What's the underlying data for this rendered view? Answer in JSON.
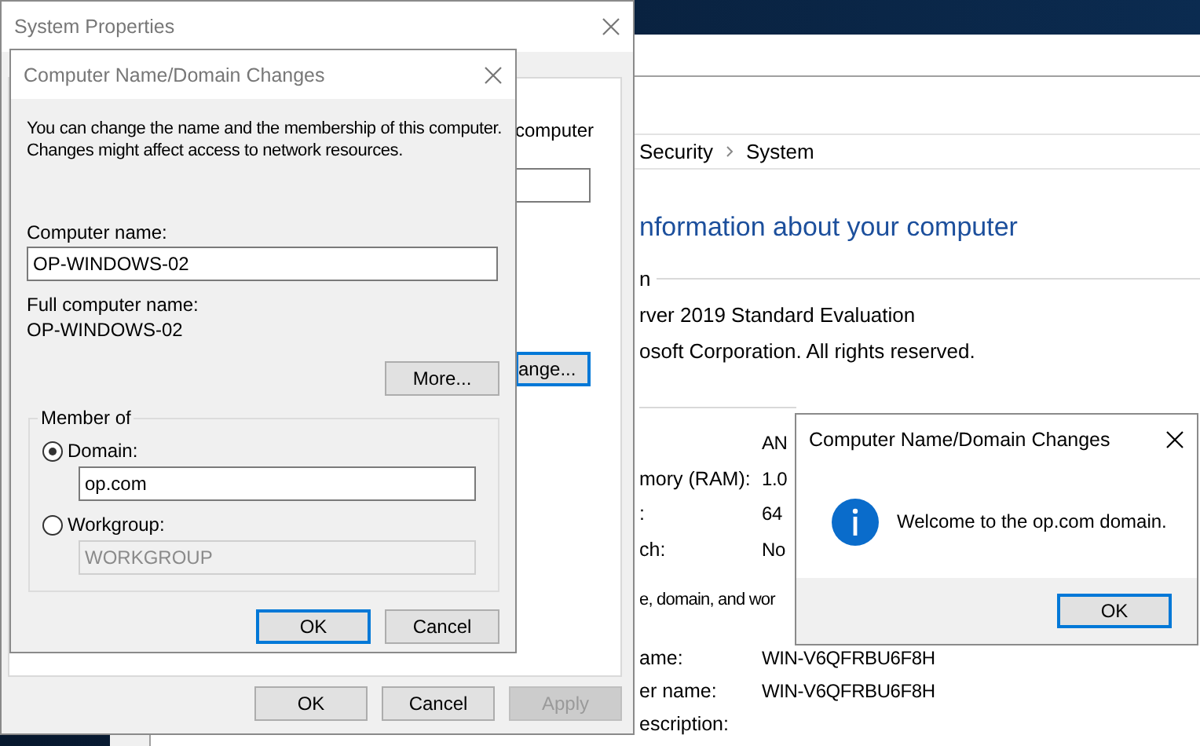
{
  "system_window": {
    "breadcrumb": [
      "Security",
      "System"
    ],
    "heading": "nformation about your computer",
    "edition_label": "n",
    "edition_lines": [
      "rver 2019 Standard Evaluation",
      "osoft Corporation. All rights reserved."
    ],
    "system_rows": [
      {
        "value": "AN"
      },
      {
        "label": "mory (RAM):",
        "value": "1.0"
      },
      {
        "label": ":",
        "value": "64"
      },
      {
        "label": "ch:",
        "value": "No"
      }
    ],
    "name_section_label": "e, domain, and wor",
    "name_rows": [
      {
        "label": "ame:",
        "value": "WIN-V6QFRBU6F8H"
      },
      {
        "label": "er name:",
        "value": "WIN-V6QFRBU6F8H"
      },
      {
        "label": "escription:"
      }
    ]
  },
  "system_properties": {
    "title": "System Properties",
    "active": false,
    "peek_text": "computer",
    "peek_button": "ange...",
    "buttons": [
      {
        "label": "OK",
        "disabled": false
      },
      {
        "label": "Cancel",
        "disabled": false
      },
      {
        "label": "Apply",
        "disabled": true
      }
    ]
  },
  "name_dialog": {
    "title": "Computer Name/Domain Changes",
    "active": false,
    "description": "You can change the name and the membership of this computer. Changes might affect access to network resources.",
    "computer_name_label": "Computer name:",
    "computer_name": "OP-WINDOWS-02",
    "full_name_label": "Full computer name:",
    "full_name": "OP-WINDOWS-02",
    "more_button": "More...",
    "member_of": {
      "legend": "Member of",
      "options": [
        {
          "label": "Domain:",
          "selected": true,
          "value": "op.com"
        },
        {
          "label": "Workgroup:",
          "selected": false,
          "value": "WORKGROUP"
        }
      ]
    },
    "buttons": [
      {
        "label": "OK",
        "default": true
      },
      {
        "label": "Cancel",
        "default": false
      }
    ]
  },
  "message_box": {
    "title": "Computer Name/Domain Changes",
    "active": true,
    "message": "Welcome to the op.com domain.",
    "buttons": [
      {
        "label": "OK",
        "default": true
      }
    ]
  }
}
